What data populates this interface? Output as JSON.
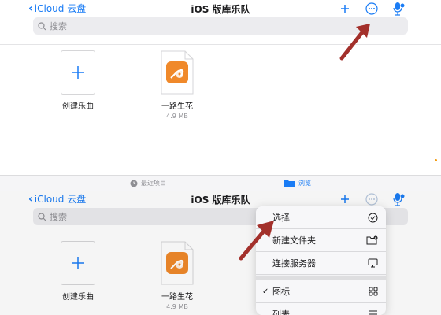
{
  "top": {
    "back_label": "iCloud 云盘",
    "title": "iOS 版库乐队",
    "search_placeholder": "搜索",
    "files": [
      {
        "name": "创建乐曲",
        "size": ""
      },
      {
        "name": "一路生花",
        "size": "4.9 MB"
      }
    ]
  },
  "tabbar": {
    "recent_label": "最近项目",
    "browse_label": "浏览"
  },
  "bottom": {
    "back_label": "iCloud 云盘",
    "title": "iOS 版库乐队",
    "search_placeholder": "搜索",
    "files": [
      {
        "name": "创建乐曲",
        "size": ""
      },
      {
        "name": "一路生花",
        "size": "4.9 MB"
      }
    ]
  },
  "menu": {
    "items": [
      {
        "label": "选择",
        "icon": "checkmark-circle-icon",
        "checked": false
      },
      {
        "label": "新建文件夹",
        "icon": "folder-badge-plus-icon",
        "checked": false
      },
      {
        "label": "连接服务器",
        "icon": "desktop-icon",
        "checked": false
      },
      {
        "label": "图标",
        "icon": "grid-icon",
        "checked": true
      },
      {
        "label": "列表",
        "icon": "list-icon",
        "checked": false
      }
    ]
  },
  "colors": {
    "accent": "#1a7cf5",
    "arrow": "#a3302b",
    "guitar_tile": "#f0892a"
  }
}
